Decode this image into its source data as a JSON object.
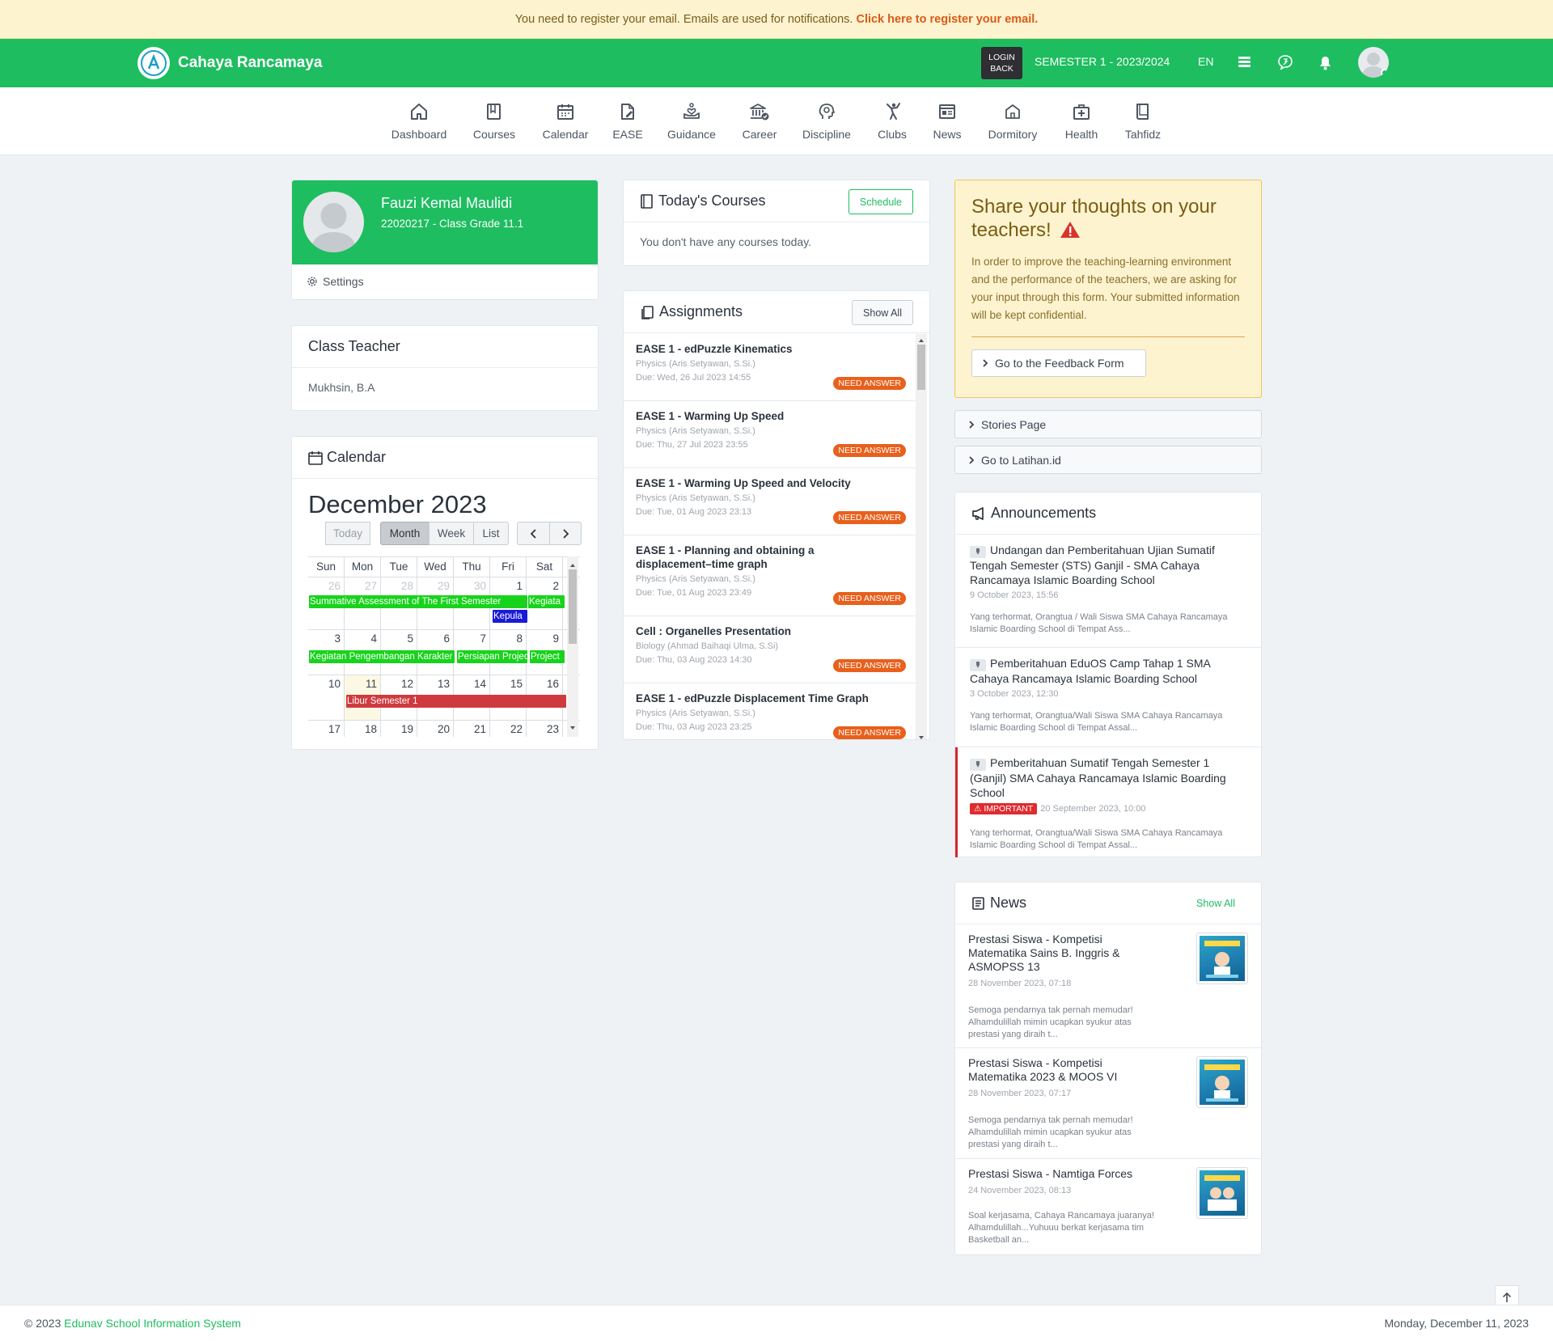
{
  "email_bar": {
    "text": "You need to register your email. Emails are used for notifications.",
    "link": "Click here to register your email."
  },
  "topbar": {
    "brand": "Cahaya Rancamaya",
    "login_back": "LOGIN BACK",
    "semester": "SEMESTER 1 - 2023/2024",
    "lang": "EN"
  },
  "nav": [
    {
      "label": "Dashboard",
      "icon": "home-icon"
    },
    {
      "label": "Courses",
      "icon": "book-icon"
    },
    {
      "label": "Calendar",
      "icon": "calendar-icon"
    },
    {
      "label": "EASE",
      "icon": "edit-doc-icon"
    },
    {
      "label": "Guidance",
      "icon": "hand-heart-icon"
    },
    {
      "label": "Career",
      "icon": "bank-icon"
    },
    {
      "label": "Discipline",
      "icon": "head-icon"
    },
    {
      "label": "Clubs",
      "icon": "karate-icon"
    },
    {
      "label": "News",
      "icon": "newspaper-icon"
    },
    {
      "label": "Dormitory",
      "icon": "house-icon"
    },
    {
      "label": "Health",
      "icon": "medkit-icon"
    },
    {
      "label": "Tahfidz",
      "icon": "quran-icon"
    }
  ],
  "profile": {
    "name": "Fauzi Kemal Maulidi",
    "sub": "22020217 - Class Grade 11.1",
    "settings": "Settings"
  },
  "class_teacher": {
    "title": "Class Teacher",
    "name": "Mukhsin, B.A"
  },
  "calendar": {
    "title": "Calendar",
    "month": "December 2023",
    "buttons": {
      "today": "Today",
      "month": "Month",
      "week": "Week",
      "list": "List"
    },
    "weekdays": [
      "Sun",
      "Mon",
      "Tue",
      "Wed",
      "Thu",
      "Fri",
      "Sat"
    ],
    "weeks": [
      [
        "26",
        "27",
        "28",
        "29",
        "30",
        "1",
        "2"
      ],
      [
        "3",
        "4",
        "5",
        "6",
        "7",
        "8",
        "9"
      ],
      [
        "10",
        "11",
        "12",
        "13",
        "14",
        "15",
        "16"
      ],
      [
        "17",
        "18",
        "19",
        "20",
        "21",
        "22",
        "23"
      ]
    ],
    "events": {
      "e1": "Summative Assessment of The First Semester",
      "e2": "Kegiata",
      "e3": "Kepula",
      "e4": "Kegiatan Pengembangan Karakter",
      "e5": "Persiapan Project",
      "e6": "Project",
      "e7": "Libur Semester 1"
    }
  },
  "today_courses": {
    "title": "Today's Courses",
    "button": "Schedule",
    "empty": "You don't have any courses today."
  },
  "assignments": {
    "title": "Assignments",
    "button": "Show All",
    "items": [
      {
        "title": "EASE 1 - edPuzzle Kinematics",
        "sub": "Physics (Aris Setyawan, S.Si.)",
        "due": "Due: Wed, 26 Jul 2023 14:55",
        "badge": "NEED ANSWER"
      },
      {
        "title": "EASE 1 - Warming Up Speed",
        "sub": "Physics (Aris Setyawan, S.Si.)",
        "due": "Due: Thu, 27 Jul 2023 23:55",
        "badge": "NEED ANSWER"
      },
      {
        "title": "EASE 1 - Warming Up Speed and Velocity",
        "sub": "Physics (Aris Setyawan, S.Si.)",
        "due": "Due: Tue, 01 Aug 2023 23:13",
        "badge": "NEED ANSWER"
      },
      {
        "title": "EASE 1 - Planning and obtaining a displacement–time graph",
        "sub": "Physics (Aris Setyawan, S.Si.)",
        "due": "Due: Tue, 01 Aug 2023 23:49",
        "badge": "NEED ANSWER"
      },
      {
        "title": "Cell : Organelles Presentation",
        "sub": "Biology (Ahmad Baihaqi Ulma, S.Si)",
        "due": "Due: Thu, 03 Aug 2023 14:30",
        "badge": "NEED ANSWER"
      },
      {
        "title": "EASE 1 - edPuzzle Displacement Time Graph",
        "sub": "Physics (Aris Setyawan, S.Si.)",
        "due": "Due: Thu, 03 Aug 2023 23:25",
        "badge": "NEED ANSWER"
      }
    ]
  },
  "feedback": {
    "title": "Share your thoughts on your teachers!",
    "text": "In order to improve the teaching-learning environment and the performance of the teachers, we are asking for your input through this form. Your submitted information will be kept confidential.",
    "button": "Go to the Feedback Form"
  },
  "links": {
    "stories": "Stories Page",
    "latihan": "Go to Latihan.id"
  },
  "announcements": {
    "title": "Announcements",
    "items": [
      {
        "title": "Undangan dan Pemberitahuan Ujian Sumatif Tengah Semester (STS) Ganjil - SMA Cahaya Rancamaya Islamic Boarding School",
        "date": "9 October 2023, 15:56",
        "body": "Yang terhormat, Orangtua / Wali Siswa SMA Cahaya Rancamaya Islamic Boarding School di Tempat Ass..."
      },
      {
        "title": "Pemberitahuan EduOS Camp Tahap 1 SMA Cahaya Rancamaya Islamic Boarding School",
        "date": "3 October 2023, 12:30",
        "body": "Yang terhormat, Orangtua/Wali Siswa SMA Cahaya Rancamaya Islamic Boarding School di Tempat Assal..."
      },
      {
        "title": "Pemberitahuan Sumatif Tengah Semester 1 (Ganjil) SMA Cahaya Rancamaya Islamic Boarding School",
        "badge": "IMPORTANT",
        "date": "20 September 2023, 10:00",
        "body": "Yang terhormat, Orangtua/Wali Siswa SMA Cahaya Rancamaya Islamic Boarding School di Tempat Assal..."
      }
    ]
  },
  "news": {
    "title": "News",
    "show_all": "Show All",
    "items": [
      {
        "title": "Prestasi Siswa - Kompetisi Matematika Sains B. Inggris & ASMOPSS 13",
        "date": "28 November 2023, 07:18",
        "body": "Semoga pendarnya tak pernah memudar! Alhamdulillah mimin ucapkan syukur atas prestasi yang diraih t..."
      },
      {
        "title": "Prestasi Siswa - Kompetisi Matematika 2023 & MOOS VI",
        "date": "28 November 2023, 07:17",
        "body": "Semoga pendarnya tak pernah memudar! Alhamdulillah mimin ucapkan syukur atas prestasi yang diraih t..."
      },
      {
        "title": "Prestasi Siswa - Namtiga Forces",
        "date": "24 November 2023, 08:13",
        "body": "Soal kerjasama, Cahaya Rancamaya juaranya! Alhamdulillah...Yuhuuu berkat kerjasama tim Basketball an..."
      }
    ]
  },
  "footer": {
    "copy": "© 2023",
    "link": "Edunav School Information System",
    "date": "Monday, December 11, 2023"
  },
  "colors": {
    "brand": "#1ebd60",
    "need_answer": "#e8601c",
    "important": "#e02b2f",
    "event_green": "#18d31c",
    "event_blue": "#1a1ad9",
    "event_red": "#cf3a3f"
  }
}
